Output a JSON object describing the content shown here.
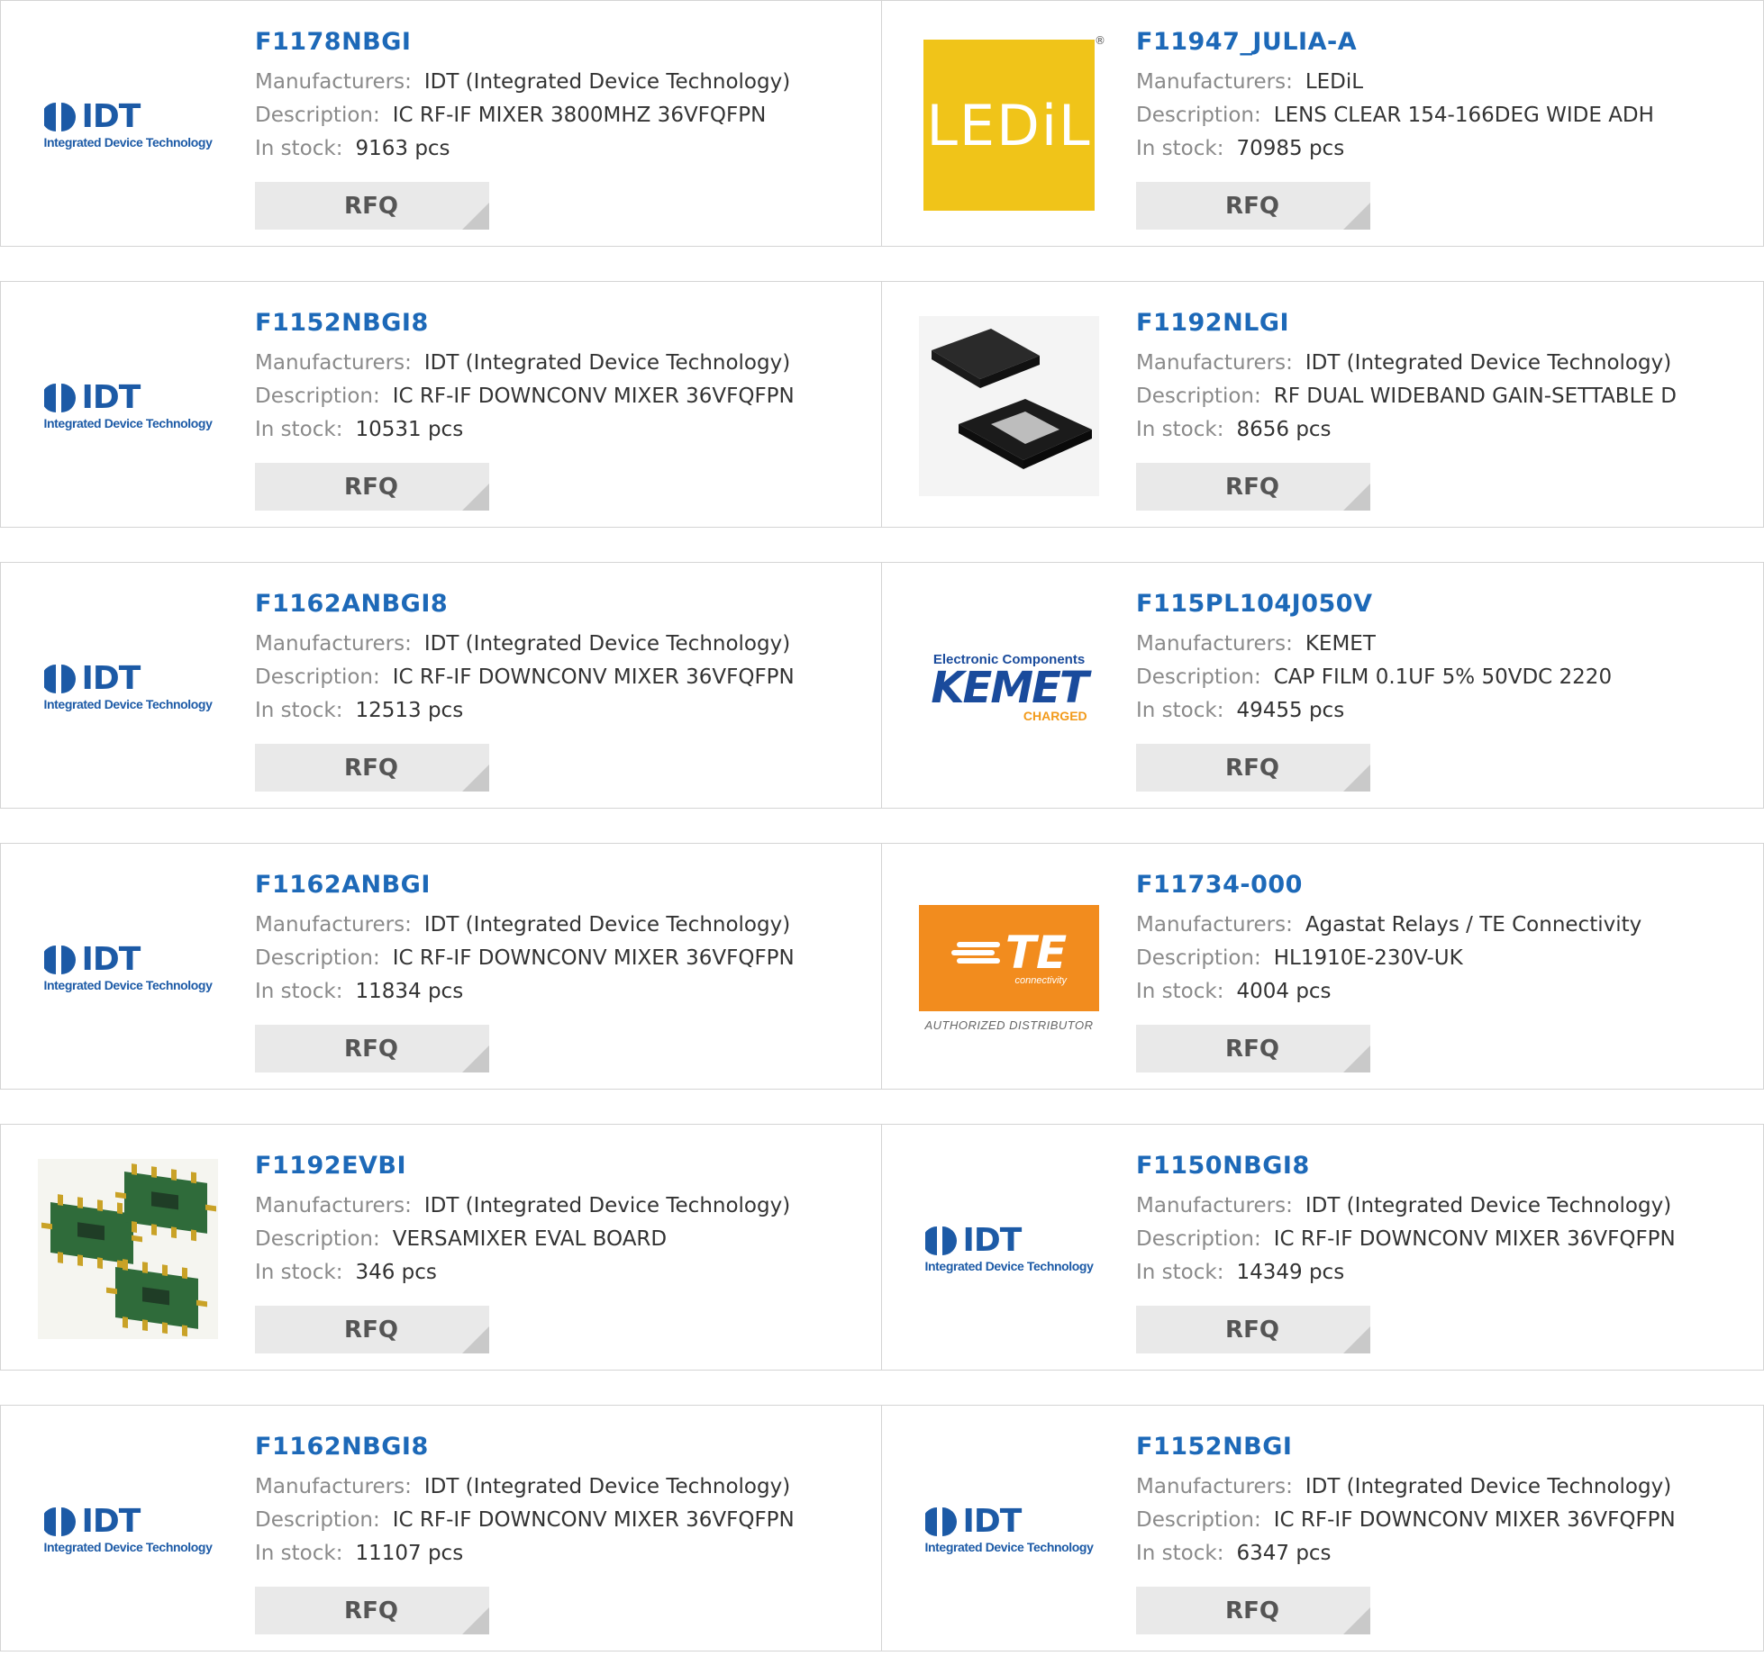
{
  "labels": {
    "manufacturers": "Manufacturers:",
    "description": "Description:",
    "in_stock": "In stock:",
    "rfq": "RFQ"
  },
  "colors": {
    "part_link": "#1d69b8",
    "label_gray": "#8a8a8a",
    "rfq_bg": "#e9e9e9",
    "idt_blue": "#1c5aa6",
    "ledil_yellow": "#f0c419",
    "kemet_blue": "#1a4b9c",
    "te_orange": "#f28c1e"
  },
  "logo_text": {
    "idt_word": "IDT",
    "idt_tagline": "Integrated Device Technology",
    "ledil": "LEDiL",
    "kemet_top": "Electronic Components",
    "kemet_word": "KEMET",
    "kemet_charged": "CHARGED",
    "te_word": "TE",
    "te_sub": "connectivity",
    "te_distributor": "AUTHORIZED DISTRIBUTOR"
  },
  "products": [
    {
      "part": "F1178NBGI",
      "manufacturer": "IDT (Integrated Device Technology)",
      "description": "IC RF-IF MIXER 3800MHZ 36VFQFPN",
      "stock": "9163 pcs",
      "image": "idt-logo"
    },
    {
      "part": "F11947_JULIA-A",
      "manufacturer": "LEDiL",
      "description": "LENS CLEAR 154-166DEG WIDE ADH",
      "stock": "70985 pcs",
      "image": "ledil-logo"
    },
    {
      "part": "F1152NBGI8",
      "manufacturer": "IDT (Integrated Device Technology)",
      "description": "IC RF-IF DOWNCONV MIXER 36VFQFPN",
      "stock": "10531 pcs",
      "image": "idt-logo"
    },
    {
      "part": "F1192NLGI",
      "manufacturer": "IDT (Integrated Device Technology)",
      "description": "RF DUAL WIDEBAND GAIN-SETTABLE D",
      "stock": "8656 pcs",
      "image": "qfn-chip-photo"
    },
    {
      "part": "F1162ANBGI8",
      "manufacturer": "IDT (Integrated Device Technology)",
      "description": "IC RF-IF DOWNCONV MIXER 36VFQFPN",
      "stock": "12513 pcs",
      "image": "idt-logo"
    },
    {
      "part": "F115PL104J050V",
      "manufacturer": "KEMET",
      "description": "CAP FILM 0.1UF 5% 50VDC 2220",
      "stock": "49455 pcs",
      "image": "kemet-logo"
    },
    {
      "part": "F1162ANBGI",
      "manufacturer": "IDT (Integrated Device Technology)",
      "description": "IC RF-IF DOWNCONV MIXER 36VFQFPN",
      "stock": "11834 pcs",
      "image": "idt-logo"
    },
    {
      "part": "F11734-000",
      "manufacturer": "Agastat Relays / TE Connectivity",
      "description": "HL1910E-230V-UK",
      "stock": "4004 pcs",
      "image": "te-logo"
    },
    {
      "part": "F1192EVBI",
      "manufacturer": "IDT (Integrated Device Technology)",
      "description": "VERSAMIXER EVAL BOARD",
      "stock": "346 pcs",
      "image": "eval-board-photo"
    },
    {
      "part": "F1150NBGI8",
      "manufacturer": "IDT (Integrated Device Technology)",
      "description": "IC RF-IF DOWNCONV MIXER 36VFQFPN",
      "stock": "14349 pcs",
      "image": "idt-logo"
    },
    {
      "part": "F1162NBGI8",
      "manufacturer": "IDT (Integrated Device Technology)",
      "description": "IC RF-IF DOWNCONV MIXER 36VFQFPN",
      "stock": "11107 pcs",
      "image": "idt-logo"
    },
    {
      "part": "F1152NBGI",
      "manufacturer": "IDT (Integrated Device Technology)",
      "description": "IC RF-IF DOWNCONV MIXER 36VFQFPN",
      "stock": "6347 pcs",
      "image": "idt-logo"
    }
  ]
}
